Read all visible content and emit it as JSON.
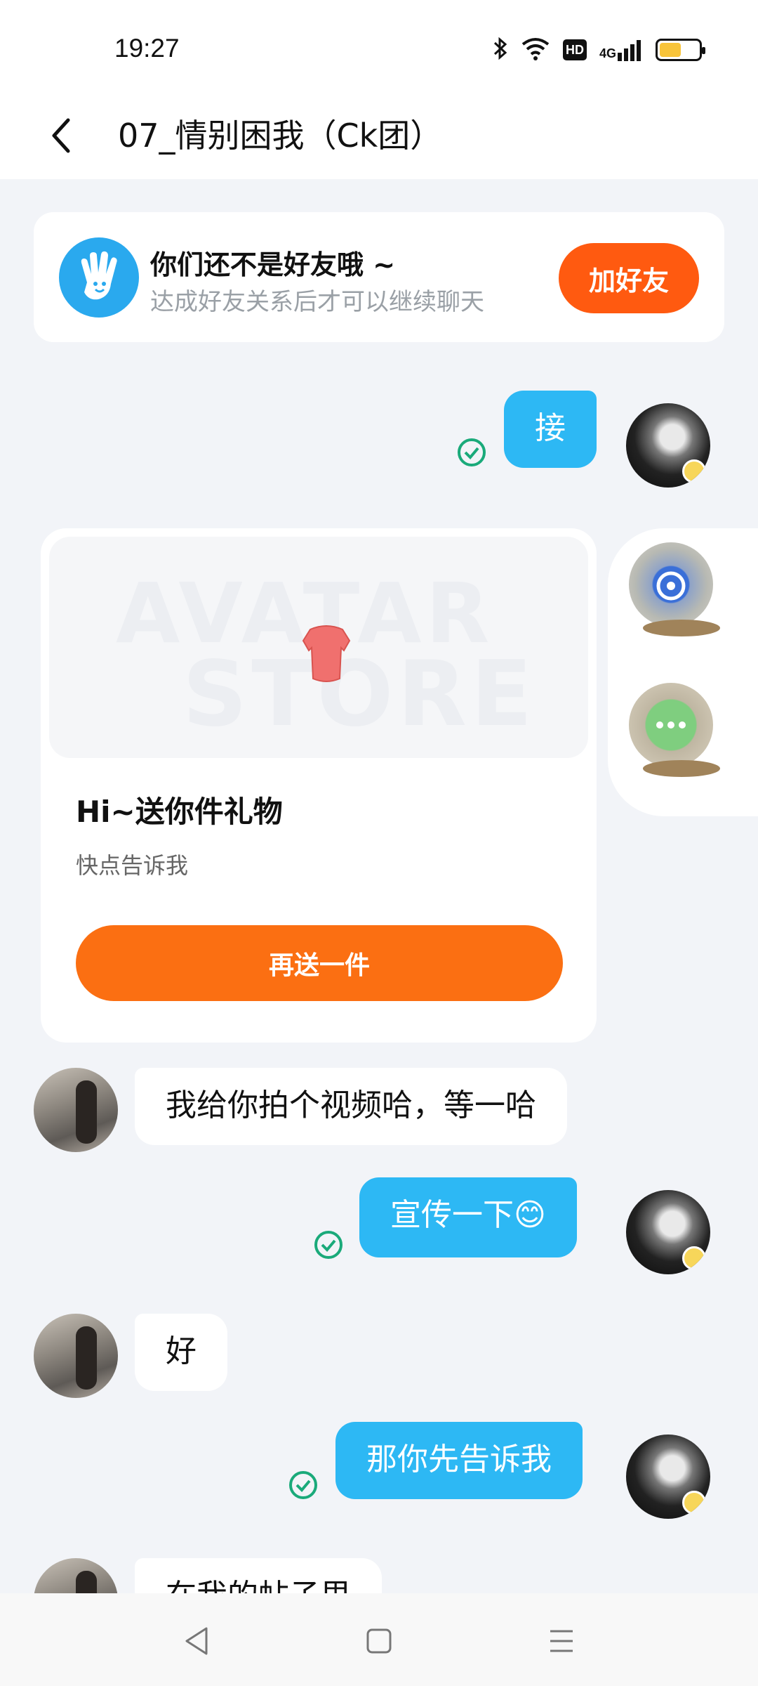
{
  "status_bar": {
    "time": "19:27",
    "hd": "HD",
    "network": "4G",
    "battery_level": 0.55
  },
  "header": {
    "title": "07_情别困我（Ck团）"
  },
  "friend_banner": {
    "title": "你们还不是好友哦 ~",
    "subtitle": "达成好友关系后才可以继续聊天",
    "button_label": "加好友"
  },
  "messages": [
    {
      "direction": "outgoing",
      "text": "接"
    },
    {
      "direction": "outgoing",
      "type": "gift_card"
    },
    {
      "direction": "incoming",
      "text": "我给你拍个视频哈，等一哈"
    },
    {
      "direction": "outgoing",
      "text": "宣传一下😊"
    },
    {
      "direction": "incoming",
      "text": "好"
    },
    {
      "direction": "outgoing",
      "text": "那你先告诉我"
    },
    {
      "direction": "incoming",
      "text": "在我的帖子里"
    }
  ],
  "gift_card": {
    "watermark_line1": "AVATAR",
    "watermark_line2": "STORE",
    "title": "Hi~送你件礼物",
    "subtitle": "快点告诉我",
    "button_label": "再送一件"
  },
  "colors": {
    "accent_orange": "#ff5a10",
    "bubble_blue": "#2db8f4",
    "check_green": "#1aaa7a"
  }
}
